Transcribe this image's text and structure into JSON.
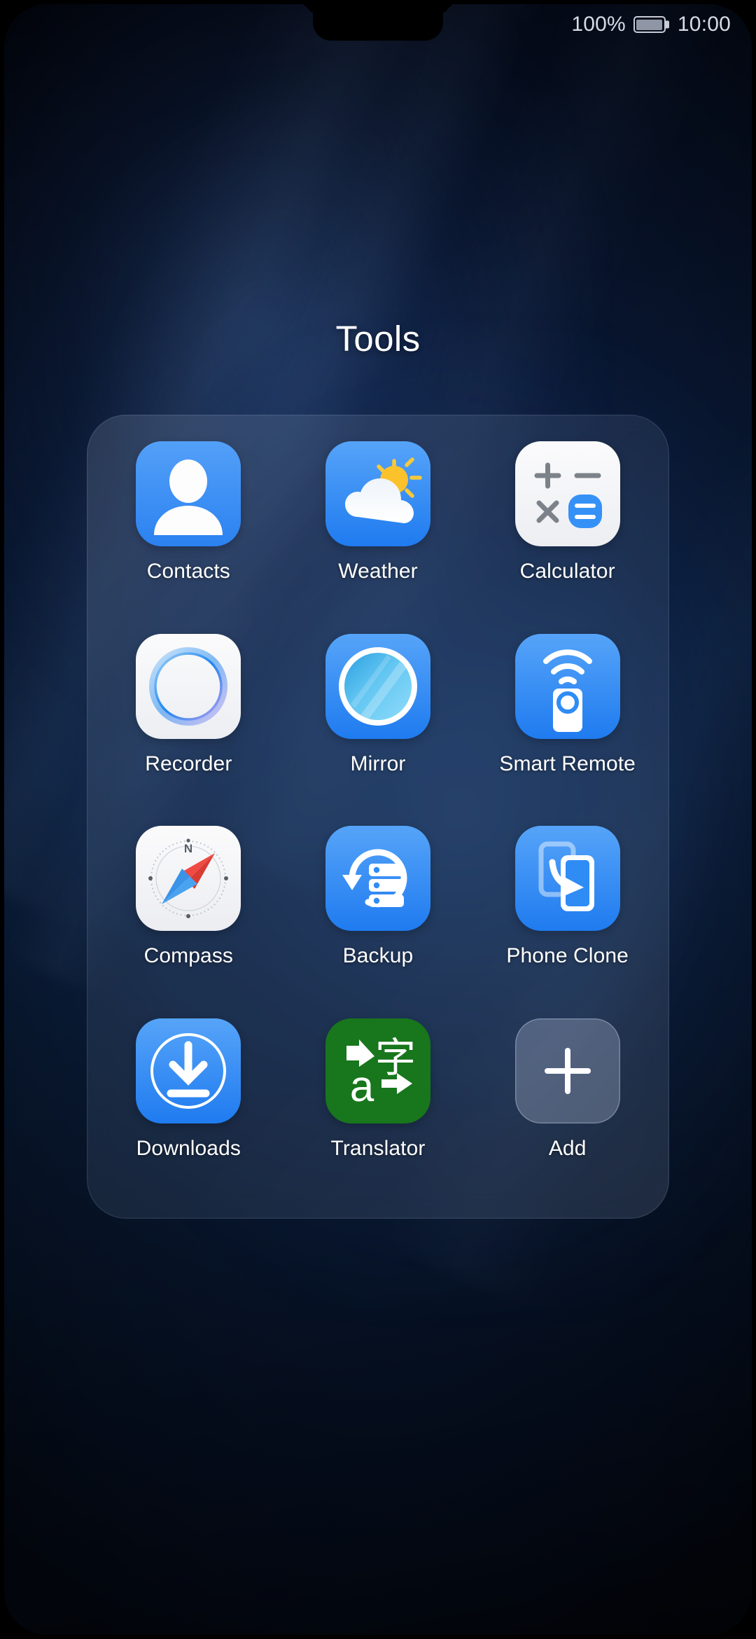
{
  "status_bar": {
    "battery_percent": "100%",
    "battery_icon": "battery-full-icon",
    "clock": "10:00"
  },
  "folder": {
    "title": "Tools",
    "apps": [
      {
        "label": "Contacts",
        "icon": "contacts-icon",
        "color": "#3d91f5"
      },
      {
        "label": "Weather",
        "icon": "weather-icon",
        "color": "#2f8cf5"
      },
      {
        "label": "Calculator",
        "icon": "calculator-icon",
        "color": "#f4f5f7"
      },
      {
        "label": "Recorder",
        "icon": "recorder-icon",
        "color": "#f4f5f7"
      },
      {
        "label": "Mirror",
        "icon": "mirror-icon",
        "color": "#2f8cf5"
      },
      {
        "label": "Smart Remote",
        "icon": "smart-remote-icon",
        "color": "#2f8cf5"
      },
      {
        "label": "Compass",
        "icon": "compass-icon",
        "color": "#f4f5f7"
      },
      {
        "label": "Backup",
        "icon": "backup-icon",
        "color": "#2f8cf5"
      },
      {
        "label": "Phone Clone",
        "icon": "phone-clone-icon",
        "color": "#2f8cf5"
      },
      {
        "label": "Downloads",
        "icon": "downloads-icon",
        "color": "#2f8cf5"
      },
      {
        "label": "Translator",
        "icon": "translator-icon",
        "color": "#1a7a1f"
      },
      {
        "label": "Add",
        "icon": "plus-icon",
        "color": "#8a93a8"
      }
    ]
  },
  "theme": {
    "accent_blue": "#2f8cf5",
    "translator_green": "#1a7a1f",
    "text_primary": "#ffffff",
    "status_text": "#d7dbe4",
    "wallpaper_dark": "#050a1a",
    "wallpaper_mid": "#0d2448"
  }
}
